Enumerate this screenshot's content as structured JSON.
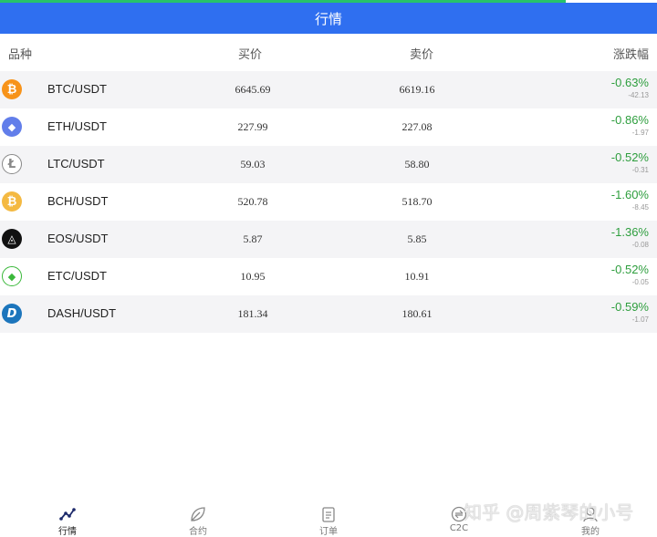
{
  "header": {
    "title": "行情"
  },
  "columns": {
    "symbol": "品种",
    "buy": "买价",
    "sell": "卖价",
    "change": "涨跌幅"
  },
  "rows": [
    {
      "icon": "bitcoin-icon",
      "glyph": "₿",
      "color": "#f7931a",
      "pair": "BTC/USDT",
      "buy": "6645.69",
      "sell": "6619.16",
      "pct": "-0.63%",
      "delta": "-42.13"
    },
    {
      "icon": "ethereum-icon",
      "glyph": "◆",
      "color": "#627eea",
      "pair": "ETH/USDT",
      "buy": "227.99",
      "sell": "227.08",
      "pct": "-0.86%",
      "delta": "-1.97"
    },
    {
      "icon": "litecoin-icon",
      "glyph": "Ł",
      "color": "#a6a6a6",
      "pair": "LTC/USDT",
      "buy": "59.03",
      "sell": "58.80",
      "pct": "-0.52%",
      "delta": "-0.31"
    },
    {
      "icon": "bitcoin-cash-icon",
      "glyph": "₿",
      "color": "#f4b942",
      "pair": "BCH/USDT",
      "buy": "520.78",
      "sell": "518.70",
      "pct": "-1.60%",
      "delta": "-8.45"
    },
    {
      "icon": "eos-icon",
      "glyph": "◬",
      "color": "#111111",
      "pair": "EOS/USDT",
      "buy": "5.87",
      "sell": "5.85",
      "pct": "-1.36%",
      "delta": "-0.08"
    },
    {
      "icon": "ethereum-classic-icon",
      "glyph": "◆",
      "color": "#3ab83a",
      "pair": "ETC/USDT",
      "buy": "10.95",
      "sell": "10.91",
      "pct": "-0.52%",
      "delta": "-0.05"
    },
    {
      "icon": "dash-icon",
      "glyph": "D",
      "color": "#1c75bc",
      "pair": "DASH/USDT",
      "buy": "181.34",
      "sell": "180.61",
      "pct": "-0.59%",
      "delta": "-1.07"
    }
  ],
  "tabs": [
    {
      "label": "行情",
      "icon": "market-chart-icon"
    },
    {
      "label": "合约",
      "icon": "contract-leaf-icon"
    },
    {
      "label": "订单",
      "icon": "order-clipboard-icon"
    },
    {
      "label": "C2C",
      "icon": "c2c-icon"
    },
    {
      "label": "我的",
      "icon": "profile-user-icon"
    }
  ],
  "watermark": "知乎 @周紫琴的小号",
  "colors": {
    "header": "#2f6ff0",
    "negative": "#2e9e3e",
    "accent": "#27c36a"
  }
}
